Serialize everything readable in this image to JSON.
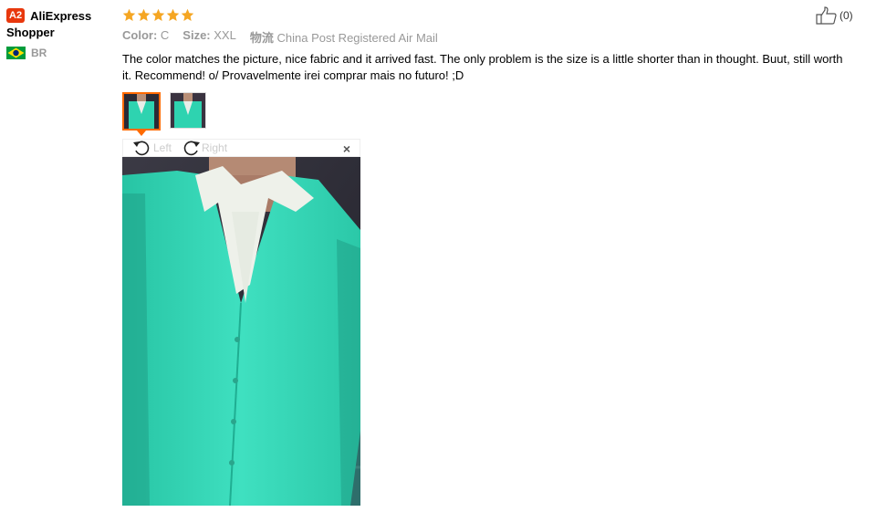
{
  "user": {
    "badge": "A2",
    "name_line1": "AliExpress",
    "name_line2": "Shopper",
    "country": "BR"
  },
  "rating": {
    "stars": 5,
    "color": "#f5a623"
  },
  "specs": [
    {
      "label": "Color:",
      "value": "C"
    },
    {
      "label": "Size:",
      "value": "XXL"
    },
    {
      "label": "物流",
      "value": "China Post Registered Air Mail"
    }
  ],
  "review_text": "The color matches the picture, nice fabric and it arrived fast. The only problem is the size is a little shorter than in thought. Buut, still worth it. Recommend! o/ Provavelmente irei comprar mais no futuro! ;D",
  "like": {
    "count": "(0)",
    "icon": "thumbs-up-icon"
  },
  "viewer": {
    "left_label": "Left",
    "right_label": "Right",
    "close": "×"
  },
  "colors": {
    "accent": "#ff6a00",
    "badge": "#e8380d",
    "cardigan": "#2ed3b0"
  }
}
